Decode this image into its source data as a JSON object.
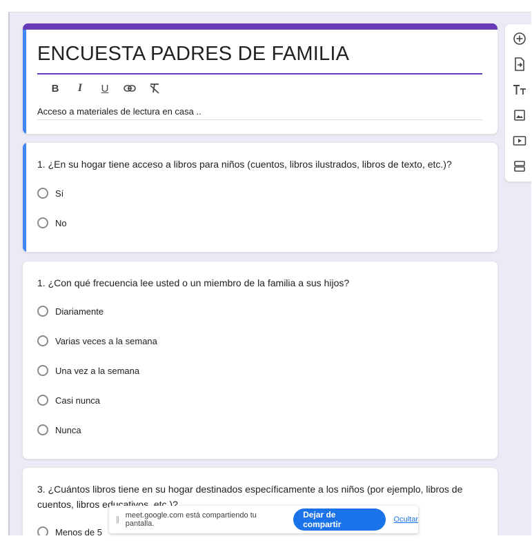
{
  "form": {
    "title": "ENCUESTA PADRES DE FAMILIA",
    "description": "Acceso a materiales de lectura en casa ..",
    "format_buttons": [
      {
        "label": "B",
        "icon": "bold-icon"
      },
      {
        "label": "I",
        "icon": "italic-icon"
      },
      {
        "label": "U",
        "icon": "underline-icon"
      },
      {
        "label": "",
        "icon": "link-icon"
      },
      {
        "label": "",
        "icon": "clear-format-icon"
      }
    ]
  },
  "questions": [
    {
      "text": "1. ¿En su hogar tiene acceso a libros para niños (cuentos, libros ilustrados, libros de texto, etc.)?",
      "options": [
        "Sí",
        "No"
      ]
    },
    {
      "text": "1. ¿Con qué frecuencia lee usted o un miembro de la familia a sus hijos?",
      "options": [
        "Diariamente",
        "Varias veces a la semana",
        "Una vez a la semana",
        "Casi nunca",
        "Nunca"
      ]
    },
    {
      "text": "3. ¿Cuántos libros tiene en su hogar destinados específicamente a los niños (por ejemplo, libros de cuentos, libros educativos, etc.)?",
      "options": [
        "Menos de 5"
      ]
    }
  ],
  "sidebar_tools": [
    "add-question-icon",
    "import-questions-icon",
    "add-title-icon",
    "add-image-icon",
    "add-video-icon",
    "add-section-icon"
  ],
  "share_bar": {
    "grip": "||",
    "message": "meet.google.com está compartiendo tu pantalla.",
    "stop_label": "Dejar de compartir",
    "hide_label": "Ocultar"
  },
  "colors": {
    "theme": "#673ab7",
    "active_accent": "#4285f4",
    "background": "#eceaf4",
    "share_button": "#1a73e8"
  }
}
